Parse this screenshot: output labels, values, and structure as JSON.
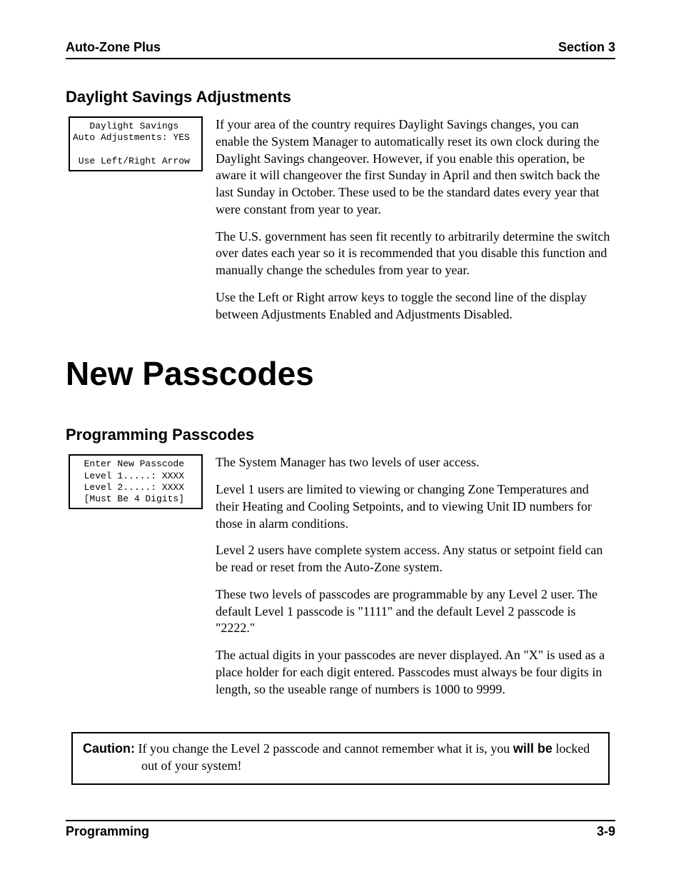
{
  "header": {
    "left": "Auto-Zone Plus",
    "right": "Section 3"
  },
  "footer": {
    "left": "Programming",
    "right": "3-9"
  },
  "section_daylight": {
    "heading": "Daylight Savings Adjustments",
    "lcd": "   Daylight Savings\nAuto Adjustments: YES\n\n Use Left/Right Arrow",
    "paragraphs": [
      "If your area of the country requires Daylight Savings changes, you can enable the System Manager to automatically reset its own clock during the Daylight Savings changeover. However, if you enable this operation, be aware it will changeover the first Sunday in April and then switch back the last Sunday in October. These used to be the standard dates every year that were constant from year to year.",
      "The U.S. government has seen fit recently to arbitrarily determine the switch over dates each year so it is recommended that you disable this function and manually change the schedules from year to year.",
      "Use the Left or Right arrow keys to toggle the second line of the display between Adjustments Enabled and Adjustments Disabled."
    ]
  },
  "big_title": "New Passcodes",
  "section_passcodes": {
    "heading": "Programming Passcodes",
    "lcd": "  Enter New Passcode\n  Level 1.....: XXXX\n  Level 2.....: XXXX\n  [Must Be 4 Digits]",
    "paragraphs": [
      "The System Manager has two levels of user access.",
      "Level 1 users are limited to viewing or changing Zone Temperatures and their Heating and Cooling Setpoints, and to viewing Unit ID numbers for those in alarm conditions.",
      "Level 2 users have complete system access. Any status or setpoint field can be read or reset from the Auto-Zone system.",
      "These two levels of passcodes are programmable by any Level 2 user. The default Level 1 passcode is \"1111\" and the default Level 2 passcode is \"2222.\"",
      "The actual digits in your passcodes are never displayed. An \"X\" is used as a place holder for each digit entered. Passcodes must always be four digits in length, so the useable range of numbers is 1000 to 9999."
    ]
  },
  "caution": {
    "label": "Caution:",
    "text_before": " If you change the Level 2 passcode and cannot remember what it is, you ",
    "strong": "will be",
    "text_after": " locked out of your system!"
  }
}
